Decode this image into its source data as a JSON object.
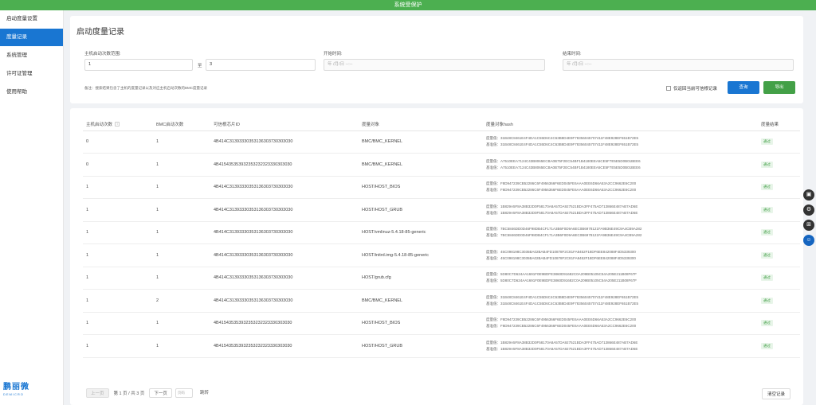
{
  "banner": "系统受保护",
  "sidebar": {
    "items": [
      {
        "label": "启动度量设置"
      },
      {
        "label": "度量记录"
      },
      {
        "label": "系统管理"
      },
      {
        "label": "许可证管理"
      },
      {
        "label": "使用帮助"
      }
    ],
    "logo_mark": "鹏丽微",
    "logo_sub": "DEMICRO"
  },
  "page": {
    "title": "启动度量记录",
    "filters": {
      "range_label": "主机启动次数范围:",
      "range_from": "1",
      "range_sep": "至",
      "range_to": "3",
      "start_label": "开始时间:",
      "start_placeholder": "年 /月/日 --:--",
      "end_label": "结束时间:",
      "end_placeholder": "年 /月/日 --:--"
    },
    "note": "备注：搜索结果包含了主机的度量记录以及对应主机启动次数的BMC度量记录",
    "checkbox_label": "仅返回当前可信根记录",
    "query_btn": "查询",
    "export_btn": "导出"
  },
  "table": {
    "headers": [
      "主机启动次数",
      "BMC启动次数",
      "可信根芯片ID",
      "度量对象",
      "度量对象hash",
      "度量结果"
    ],
    "sort_icon": "↕",
    "prefix_measured": "度量值：",
    "prefix_baseline": "基准值：",
    "rows": [
      {
        "host": "0",
        "bmc": "1",
        "chip": "4B414C31393330353136303730303030",
        "obj": "BMC/BMC_KERNEL",
        "m": "31B48C8461E4F4DA1C55D6C4C63B8D4E9F78356045707411F48E928EF651B72E5",
        "b": "31B48C8461E4F4DA1C55D6C4C63B8D4E9F78356045707411F48E928EF651B72E5",
        "r": "通过"
      },
      {
        "host": "0",
        "bmc": "1",
        "chip": "4B415435353932353232323330303030",
        "obj": "BMC/BMC_KERNEL",
        "m": "A7510EEA7124C43B8065ECBA0B75F2EC54BF1B4180EEA5CE5F7E5E5D0B01BEE6",
        "b": "A7510EEA7124C43B8065ECBA0B75F2EC54BF1B4180EEA5CE5F7E5E5D0B01BEE6",
        "r": "通过"
      },
      {
        "host": "1",
        "bmc": "1",
        "chip": "4B414C31393330353136303730303030",
        "obj": "HOST/HOST_BIOS",
        "m": "F8D947239CB52286C6F4956366F6ED045FE6AAA0EE6D66A53A2CC9662E6C200",
        "b": "F8D947239CB52286C6F4956366F6ED045FE6AAA0EE6D66A53A2CC9662E6C200",
        "r": "通过"
      },
      {
        "host": "1",
        "bmc": "1",
        "chip": "4B414C31393330353136303730303030",
        "obj": "HOST/HOST_GRUB",
        "m": "1B829A5F8A38B32D0F58170A8A57DA927521BDA3FF475AD713866E487AB7AD6E",
        "b": "1B829A5F8A38B32D0F58170A8A57DA927521BDA3FF475AD713866E487AB7AD6E",
        "r": "通过"
      },
      {
        "host": "1",
        "bmc": "1",
        "chip": "4B414C31393330353136303730303030",
        "obj": "HOST/vmlinuz-5.4.18-85-generic",
        "m": "7BC5846DD0D46F98DB4CF171A3B6F0D9A6EC0B6978121FA9B36E49C9A4CB9A282",
        "b": "7BC5846DD0D46F98DB4CF171A3B6F0D9A6EC0B6978121FA9B36E49C9A4CB9A282",
        "r": "通过"
      },
      {
        "host": "1",
        "bmc": "1",
        "chip": "4B414C31393330353136303730303030",
        "obj": "HOST/initrd.img-5.4.18-85-generic",
        "m": "45C098198C3035BA02BAB4FD10878F2C81FA8452F18DF6EE842088F4D5339300",
        "b": "45C098198C3035BA02BAB4FD10878F2C81FA8452F18DF6EE842088F4D5339300",
        "r": "通过"
      },
      {
        "host": "1",
        "bmc": "1",
        "chip": "4B414C31393330353136303730303030",
        "obj": "HOST/grub.cfg",
        "m": "5D80C7D624AA1691F0E9BDFE3860D91682C0A209B05105C54A205E211B08F67F",
        "b": "5D80C7D624AA1691F0E9BDFE3860D91682C0A209B05105C54A205E211B08F67F",
        "r": "通过"
      },
      {
        "host": "1",
        "bmc": "2",
        "chip": "4B414C31393330353136303730303030",
        "obj": "BMC/BMC_KERNEL",
        "m": "31B48C8461E4F4DA1C55D6C4C63B8D4E9F78356045707411F48E928EF651B72E5",
        "b": "31B48C8461E4F4DA1C55D6C4C63B8D4E9F78356045707411F48E928EF651B72E5",
        "r": "通过"
      },
      {
        "host": "1",
        "bmc": "1",
        "chip": "4B415435353932353232323330303030",
        "obj": "HOST/HOST_BIOS",
        "m": "F8D947239CB52286C6F4956366F6ED045FE6AAA0EE6D66A53A2CC9662E6C200",
        "b": "F8D947239CB52286C6F4956366F6ED045FE6AAA0EE6D66A53A2CC9662E6C200",
        "r": "通过"
      },
      {
        "host": "1",
        "bmc": "1",
        "chip": "4B415435353932353232323330303030",
        "obj": "HOST/HOST_GRUB",
        "m": "1B829A5F8A38B32D0F58170A8A57DA927521BDA3FF475AD713866E487AB7AD6E",
        "b": "1B829A5F8A38B32D0F58170A8A57DA927521BDA3FF475AD713866E487AB7AD6E",
        "r": "通过"
      }
    ]
  },
  "pager": {
    "prev": "上一页",
    "info": "第 1 页 / 共 3 页",
    "next": "下一页",
    "input_placeholder": "页码",
    "jump": "跳转",
    "clear": "清空记录"
  },
  "colors": {
    "accent": "#1976d2",
    "banner": "#4caf50",
    "export": "#43a047"
  },
  "float_icons": [
    "window-icon",
    "settings-icon",
    "grid-icon",
    "chat-bot-icon"
  ]
}
